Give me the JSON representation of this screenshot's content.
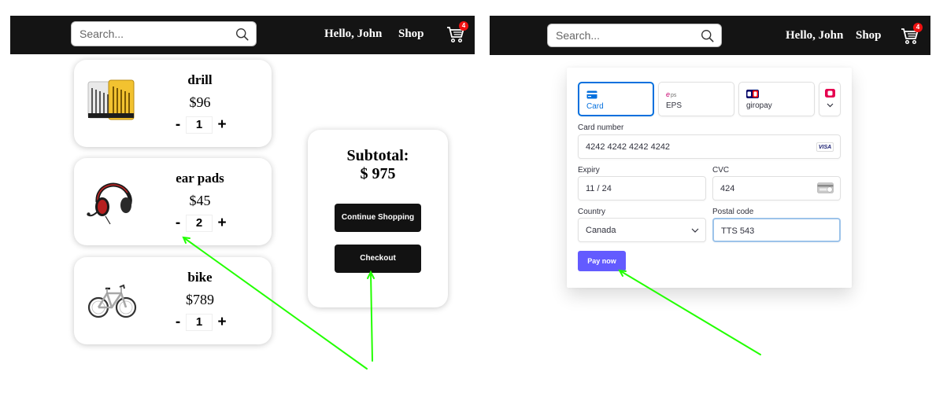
{
  "left": {
    "nav": {
      "search_placeholder": "Search...",
      "greeting": "Hello, John",
      "shop": "Shop",
      "cart_count": "4"
    },
    "products": [
      {
        "name": "drill",
        "price": "$96",
        "qty": "1",
        "image": "drill-bit-set"
      },
      {
        "name": "ear pads",
        "price": "$45",
        "qty": "2",
        "image": "gaming-headset"
      },
      {
        "name": "bike",
        "price": "$789",
        "qty": "1",
        "image": "bicycle"
      }
    ],
    "qty_minus": "-",
    "qty_plus": "+",
    "subtotal": {
      "label": "Subtotal:",
      "value": "$ 975",
      "continue_label": "Continue Shopping",
      "checkout_label": "Checkout"
    }
  },
  "right": {
    "nav": {
      "search_placeholder": "Search...",
      "greeting": "Hello, John",
      "shop": "Shop",
      "cart_count": "4"
    },
    "payment": {
      "methods": [
        {
          "label": "Card",
          "icon": "card-icon",
          "active": true
        },
        {
          "label": "EPS",
          "icon": "eps-icon",
          "active": false
        },
        {
          "label": "giropay",
          "icon": "giropay-icon",
          "active": false
        }
      ],
      "card_number_label": "Card number",
      "card_number": "4242 4242 4242 4242",
      "card_brand": "VISA",
      "expiry_label": "Expiry",
      "expiry": "11 / 24",
      "cvc_label": "CVC",
      "cvc": "424",
      "country_label": "Country",
      "country": "Canada",
      "postal_label": "Postal code",
      "postal": "TTS 543",
      "pay_label": "Pay now"
    }
  },
  "colors": {
    "navbar": "#141414",
    "accent_blue": "#0570de",
    "pay_button": "#635bff",
    "annotation_arrow": "#22ff00",
    "cart_badge": "#ee1111"
  }
}
